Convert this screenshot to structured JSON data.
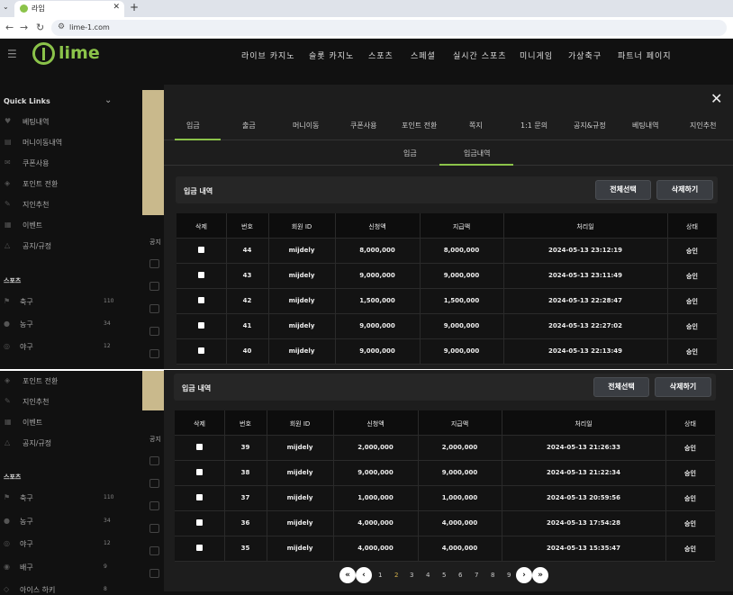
{
  "browser": {
    "tab_title": "라임",
    "url": "lime-1.com",
    "new_tab": "+",
    "tab_close": "✕",
    "tab_menu": "⌄"
  },
  "site": {
    "logo": "lime",
    "nav": [
      "라이브 카지노",
      "슬롯 카지노",
      "스포츠",
      "스페셜",
      "실시간 스포츠",
      "미니게임",
      "가상축구",
      "파트너 페이지"
    ]
  },
  "sidebar": {
    "quick_links": "Quick Links",
    "items_top": [
      "베팅내역",
      "머니이동내역",
      "쿠폰사용",
      "포인트 전환",
      "지인추천",
      "이벤트",
      "공지/규정"
    ],
    "sports_head": "스포츠",
    "sports_top": [
      {
        "name": "축구",
        "count": "110"
      },
      {
        "name": "농구",
        "count": "34"
      },
      {
        "name": "야구",
        "count": "12"
      }
    ],
    "items_bottom": [
      "포인트 전환",
      "지인추천",
      "이벤트",
      "공지/규정"
    ],
    "sports_bottom": [
      {
        "name": "축구",
        "count": "110"
      },
      {
        "name": "농구",
        "count": "34"
      },
      {
        "name": "야구",
        "count": "12"
      },
      {
        "name": "배구",
        "count": "9"
      },
      {
        "name": "아이스 하키",
        "count": "8"
      }
    ],
    "bg_label": "공지"
  },
  "modal": {
    "close": "✕",
    "tabs": [
      "입금",
      "출금",
      "머니이동",
      "쿠폰사용",
      "포인트 전환",
      "쪽지",
      "1:1 문의",
      "공지&규정",
      "베팅내역",
      "지인추천"
    ],
    "subtabs": [
      "입금",
      "입금내역"
    ]
  },
  "section": {
    "title": "입금 내역",
    "select_all": "전체선택",
    "delete": "삭제하기"
  },
  "table": {
    "headers": [
      "삭제",
      "번호",
      "회원 ID",
      "신청액",
      "지급액",
      "처리일",
      "상태"
    ],
    "rows_top": [
      {
        "no": "44",
        "id": "mijdely",
        "req": "8,000,000",
        "paid": "8,000,000",
        "date": "2024-05-13 23:12:19",
        "status": "승인"
      },
      {
        "no": "43",
        "id": "mijdely",
        "req": "9,000,000",
        "paid": "9,000,000",
        "date": "2024-05-13 23:11:49",
        "status": "승인"
      },
      {
        "no": "42",
        "id": "mijdely",
        "req": "1,500,000",
        "paid": "1,500,000",
        "date": "2024-05-13 22:28:47",
        "status": "승인"
      },
      {
        "no": "41",
        "id": "mijdely",
        "req": "9,000,000",
        "paid": "9,000,000",
        "date": "2024-05-13 22:27:02",
        "status": "승인"
      },
      {
        "no": "40",
        "id": "mijdely",
        "req": "9,000,000",
        "paid": "9,000,000",
        "date": "2024-05-13 22:13:49",
        "status": "승인"
      }
    ],
    "rows_bottom": [
      {
        "no": "39",
        "id": "mijdely",
        "req": "2,000,000",
        "paid": "2,000,000",
        "date": "2024-05-13 21:26:33",
        "status": "승인"
      },
      {
        "no": "38",
        "id": "mijdely",
        "req": "9,000,000",
        "paid": "9,000,000",
        "date": "2024-05-13 21:22:34",
        "status": "승인"
      },
      {
        "no": "37",
        "id": "mijdely",
        "req": "1,000,000",
        "paid": "1,000,000",
        "date": "2024-05-13 20:59:56",
        "status": "승인"
      },
      {
        "no": "36",
        "id": "mijdely",
        "req": "4,000,000",
        "paid": "4,000,000",
        "date": "2024-05-13 17:54:28",
        "status": "승인"
      },
      {
        "no": "35",
        "id": "mijdely",
        "req": "4,000,000",
        "paid": "4,000,000",
        "date": "2024-05-13 15:35:47",
        "status": "승인"
      }
    ]
  },
  "pagination": {
    "first": "«",
    "prev": "‹",
    "next": "›",
    "last": "»",
    "pages": [
      "1",
      "2",
      "3",
      "4",
      "5",
      "6",
      "7",
      "8",
      "9"
    ],
    "current": "2"
  },
  "colors": {
    "accent": "#8bc34a",
    "active_page": "#d4b24c"
  }
}
